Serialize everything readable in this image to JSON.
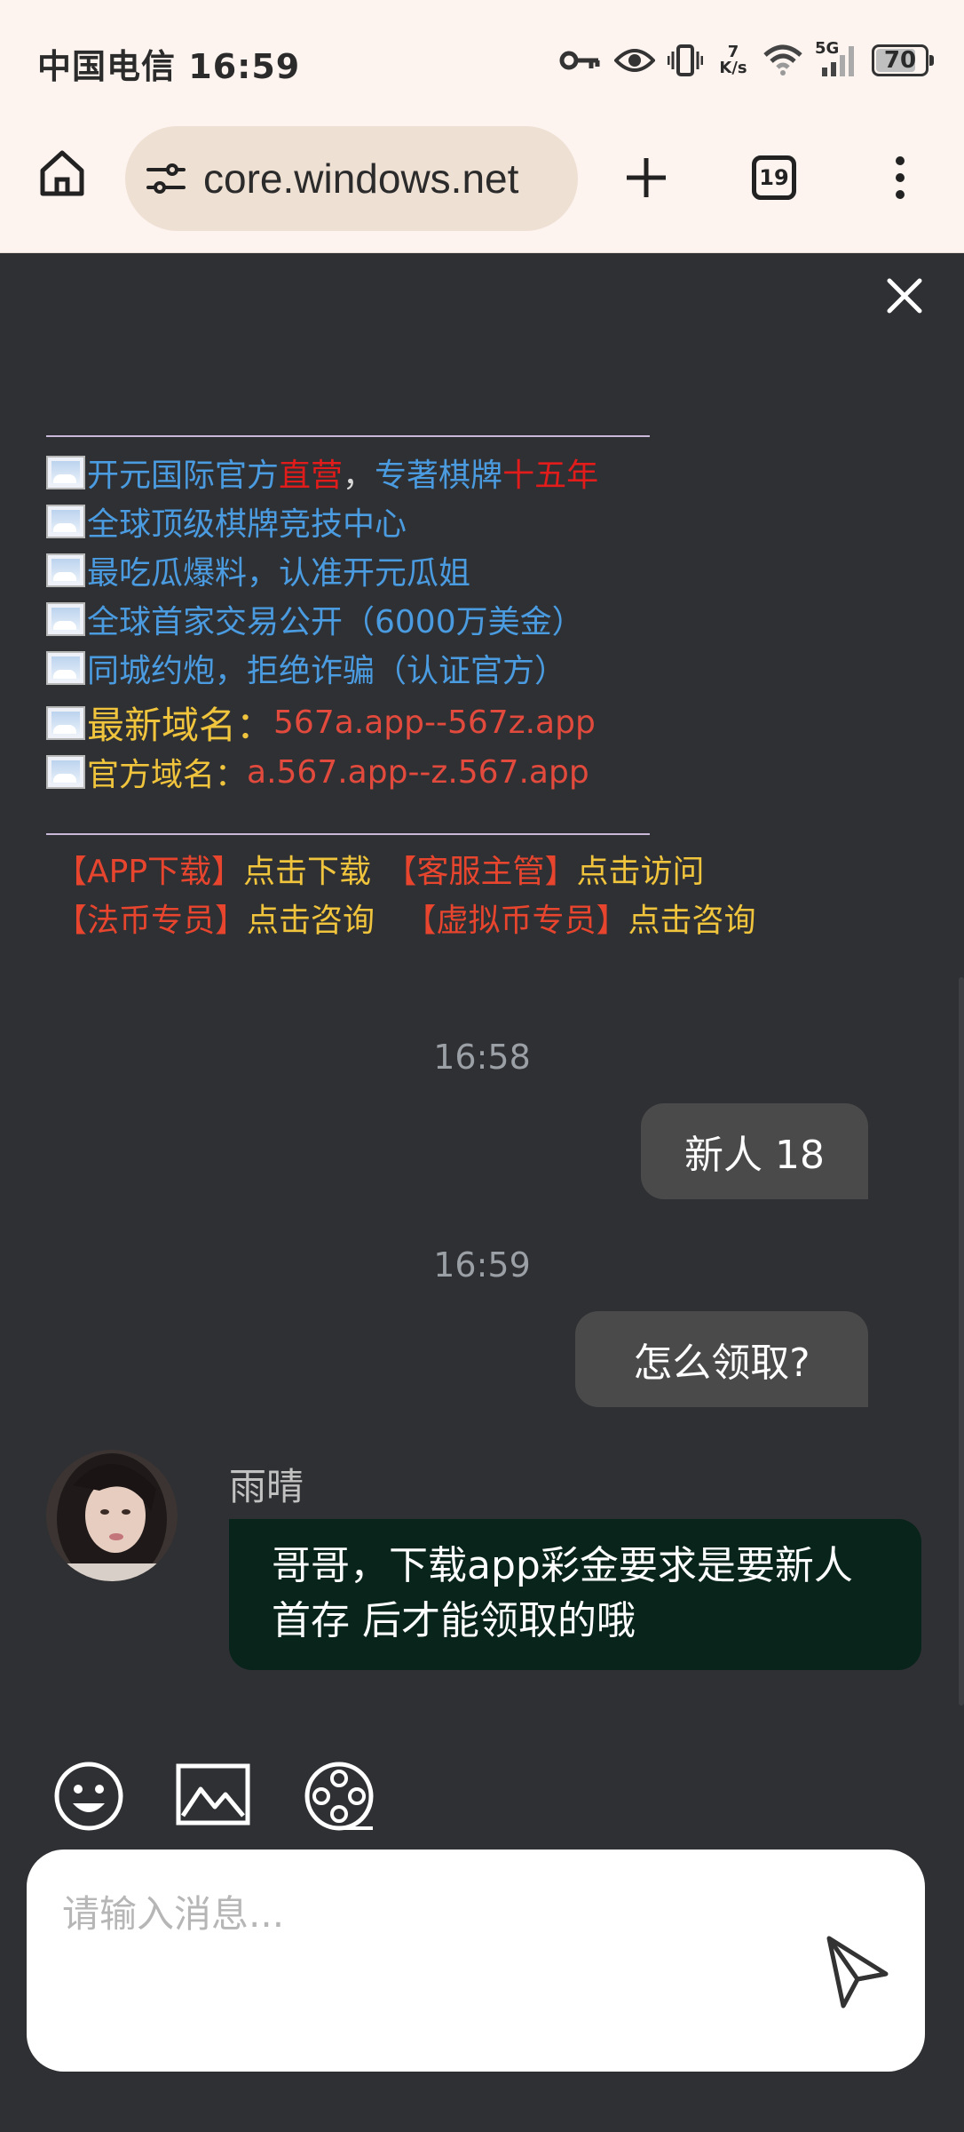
{
  "status_bar": {
    "carrier": "中国电信",
    "time": "16:59",
    "net_speed_top": "7",
    "net_speed_unit": "K/s",
    "network_type": "5G",
    "battery": "70",
    "battery_level": 0.7,
    "icons": [
      "key-icon",
      "eye-icon",
      "vibrate-icon",
      "wifi-icon",
      "signal-icon",
      "battery-icon"
    ]
  },
  "browser": {
    "url": "core.windows.net",
    "tab_count": "19",
    "icons": [
      "home-icon",
      "site-settings-icon",
      "new-tab-icon",
      "tab-switcher-icon",
      "more-menu-icon"
    ]
  },
  "promo": {
    "line1": {
      "part1": "开元国际官方",
      "part2": "直营",
      "part3": "，",
      "part4": "专著棋牌",
      "part5": "十五年"
    },
    "line2": "全球顶级棋牌竞技中心",
    "line3": "最吃瓜爆料，认准开元瓜姐",
    "line4": "全球首家交易公开（6000万美金）",
    "line5": "同城约炮，拒绝诈骗（认证官方）",
    "line6": {
      "label": "最新域名：",
      "value": "567a.app--567z.app"
    },
    "line7": {
      "label": "官方域名：",
      "value": "a.567.app--z.567.app"
    },
    "links": {
      "app_tag": "【APP下载】",
      "app_action": "点击下载",
      "service_tag": "【客服主管】",
      "service_action": "点击访问",
      "fiat_tag": "【法币专员】",
      "fiat_action": "点击咨询",
      "crypto_tag": "【虚拟币专员】",
      "crypto_action": "点击咨询"
    }
  },
  "chat": {
    "time1": "16:58",
    "msg1": "新人 18",
    "time2": "16:59",
    "msg2": "怎么领取?",
    "agent_name": "雨晴",
    "agent_msg": "哥哥，下载app彩金要求是要新人首存 后才能领取的哦"
  },
  "input": {
    "placeholder": "请输入消息..."
  },
  "colors": {
    "background": "#2f3033",
    "browser_chrome": "#fdf3ef",
    "outgoing_bubble": "#4a4a4b",
    "incoming_bubble": "#08241b",
    "link_blue": "#4a9be0",
    "highlight_red": "#e21b1b",
    "domain_yellow": "#f0c43c"
  }
}
